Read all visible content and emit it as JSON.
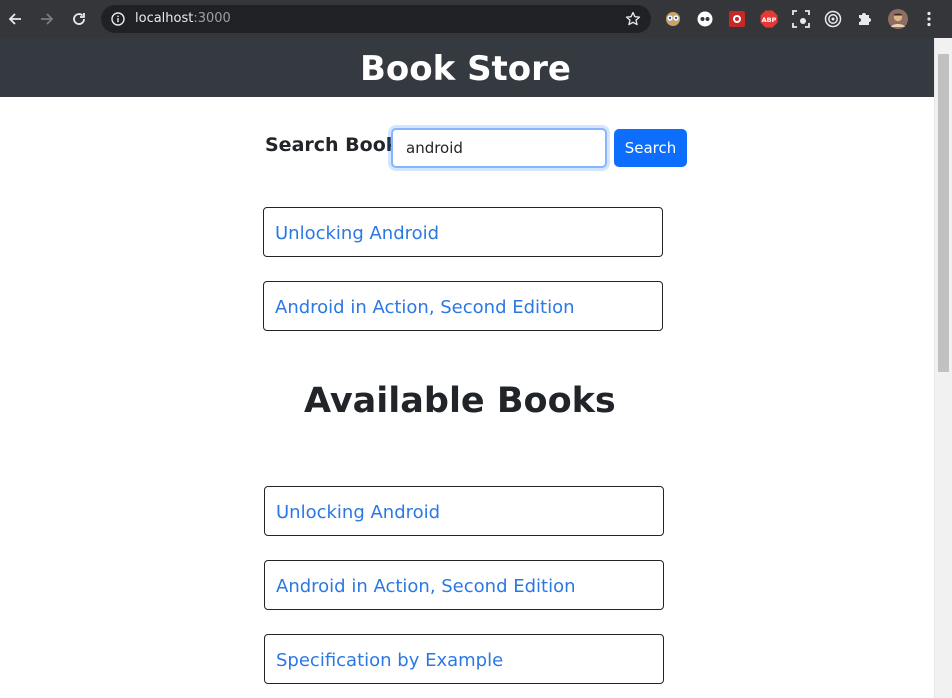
{
  "browser": {
    "url_host": "localhost",
    "url_port": ":3000",
    "extensions": [
      "eyes-extension-icon",
      "dark-reader-icon",
      "shield-extension-icon",
      "adblock-plus-icon",
      "screenshot-icon",
      "target-icon",
      "puzzle-icon",
      "profile-avatar-icon"
    ]
  },
  "header": {
    "title": "Book Store"
  },
  "search": {
    "label": "Search Book",
    "value": "android",
    "button_label": "Search"
  },
  "results": [
    {
      "title": "Unlocking Android"
    },
    {
      "title": "Android in Action, Second Edition"
    }
  ],
  "available": {
    "heading": "Available Books",
    "books": [
      {
        "title": "Unlocking Android"
      },
      {
        "title": "Android in Action, Second Edition"
      },
      {
        "title": "Specification by Example"
      }
    ]
  },
  "colors": {
    "header_bg": "#343a40",
    "primary": "#0d6efd",
    "link": "#2b78e4"
  }
}
